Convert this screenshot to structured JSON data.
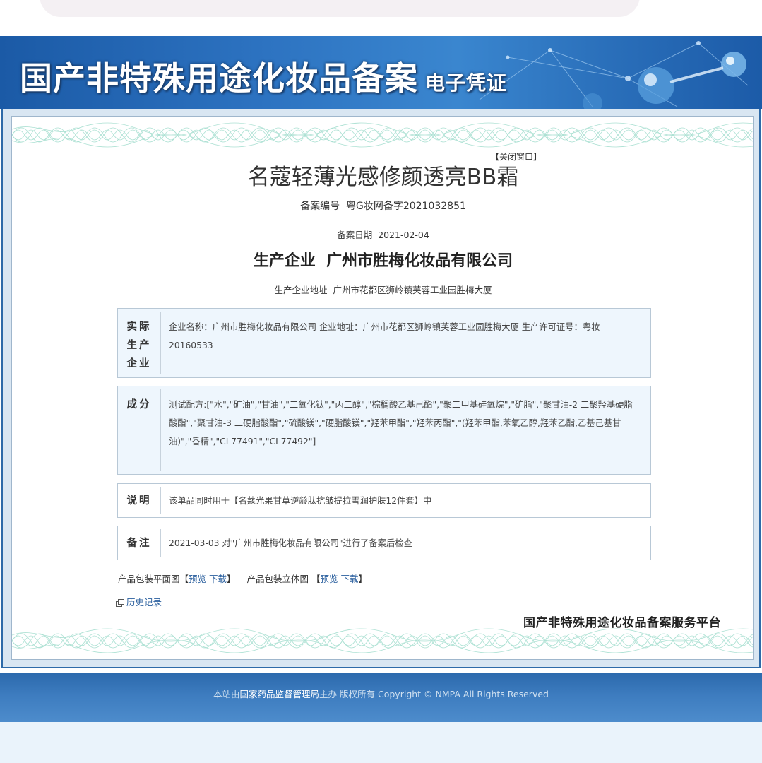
{
  "banner": {
    "title": "国产非特殊用途化妆品备案",
    "subtitle": "电子凭证"
  },
  "certificate": {
    "close_label": "【关闭窗口】",
    "product_name": "名蔻轻薄光感修颜透亮BB霜",
    "registration_no_label": "备案编号",
    "registration_no": "粤G妆网备字2021032851",
    "registration_date_label": "备案日期",
    "registration_date": "2021-02-04",
    "manufacturer_label": "生产企业",
    "manufacturer": "广州市胜梅化妆品有限公司",
    "address_label": "生产企业地址",
    "address": "广州市花都区狮岭镇芙蓉工业园胜梅大厦"
  },
  "sections": {
    "actual_producer": {
      "label_lines": [
        "实际",
        "生产",
        "企业"
      ],
      "text": "企业名称：广州市胜梅化妆品有限公司 企业地址：广州市花都区狮岭镇芙蓉工业园胜梅大厦 生产许可证号：粤妆20160533"
    },
    "ingredients": {
      "label": "成分",
      "text": "测试配方:[\"水\",\"矿油\",\"甘油\",\"二氧化钛\",\"丙二醇\",\"棕榈酸乙基己酯\",\"聚二甲基硅氧烷\",\"矿脂\",\"聚甘油-2 二聚羟基硬脂酸酯\",\"聚甘油-3 二硬脂酸酯\",\"硫酸镁\",\"硬脂酸镁\",\"羟苯甲酯\",\"羟苯丙酯\",\"(羟苯甲酯,苯氧乙醇,羟苯乙酯,乙基己基甘油)\",\"香精\",\"CI 77491\",\"CI 77492\"]"
    },
    "description": {
      "label": "说明",
      "text": "该单品同时用于【名蔻光果甘草逆龄肽抗皱提拉雪润护肤12件套】中"
    },
    "remarks": {
      "label": "备注",
      "text": "2021-03-03 对\"广州市胜梅化妆品有限公司\"进行了备案后检查"
    }
  },
  "packaging": {
    "flat_label": "产品包装平面图",
    "stereo_label": "产品包装立体图",
    "preview": "预览",
    "download": "下载"
  },
  "history_label": "历史记录",
  "platform_name": "国产非特殊用途化妆品备案服务平台",
  "footer": {
    "prefix": "本站由",
    "org": "国家药品监督管理局",
    "suffix": "主办 版权所有 Copyright © NMPA All Rights Reserved"
  },
  "colors": {
    "banner_blue": "#2d73c1",
    "link_blue": "#2a5f9e",
    "box_bg": "#eef6fd"
  }
}
